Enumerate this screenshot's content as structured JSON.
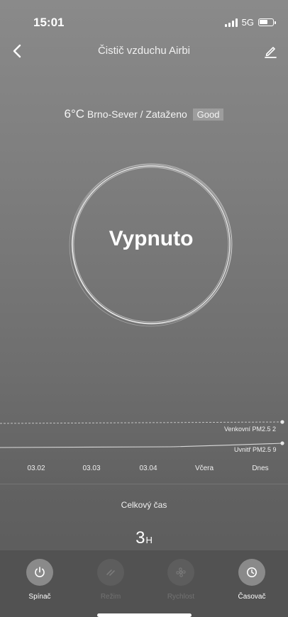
{
  "status_bar": {
    "time": "15:01",
    "network": "5G"
  },
  "header": {
    "title": "Čistič vzduchu Airbi"
  },
  "weather": {
    "temperature": "6°C",
    "location_condition": "Brno-Sever / Zataženo",
    "air_quality": "Good"
  },
  "device": {
    "power_state": "Vypnuto"
  },
  "chart_data": {
    "type": "line",
    "categories": [
      "03.02",
      "03.03",
      "03.04",
      "Včera",
      "Dnes"
    ],
    "series": [
      {
        "name": "Venkovní PM2.5",
        "current": 2,
        "style": "dashed"
      },
      {
        "name": "Uvnitř PM2.5",
        "current": 9,
        "style": "solid"
      }
    ]
  },
  "series_labels": {
    "outdoor": "Venkovní PM2.5 2",
    "indoor": "Uvnitř PM2.5 9"
  },
  "summary": {
    "label": "Celkový čas",
    "value": "3",
    "unit": "H"
  },
  "controls": [
    {
      "label": "Spínač",
      "icon": "power-icon",
      "enabled": true
    },
    {
      "label": "Režim",
      "icon": "mode-icon",
      "enabled": false
    },
    {
      "label": "Rychlost",
      "icon": "fan-icon",
      "enabled": false
    },
    {
      "label": "Časovač",
      "icon": "timer-icon",
      "enabled": true
    }
  ],
  "colors": {
    "background": "#7a7a7a",
    "bottom_bar": "#525252",
    "active_button": "#8a8a8a",
    "disabled_button": "#5d5d5d"
  }
}
